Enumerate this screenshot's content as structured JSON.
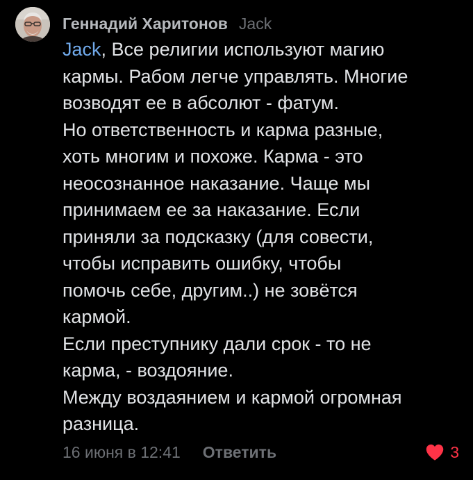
{
  "comment": {
    "author": "Геннадий Харитонов",
    "reply_to": "Jack",
    "mention": "Jack",
    "first_line_rest": ", Все религии используют магию",
    "lines": [
      "кармы. Рабом легче управлять. Многие",
      "возводят ее в абсолют - фатум.",
      "Но ответственность и карма разные,",
      "хоть многим и похоже. Карма - это",
      "неосознанное наказание. Чаще мы",
      "принимаем ее за наказание. Если",
      "приняли за подсказку (для совести,",
      "чтобы исправить ошибку, чтобы",
      "помочь себе, другим..) не зовётся",
      "кармой.",
      "Если преступнику дали срок - то не",
      "карма, - воздояние.",
      "Между воздаянием и кармой огромная",
      "разница."
    ],
    "date": "16 июня в 12:41",
    "reply_label": "Ответить",
    "like_count": "3",
    "like_icon": "heart-icon",
    "avatar_icon": "user-avatar"
  },
  "colors": {
    "background": "#000000",
    "text": "#e1e3e6",
    "author": "#b6b9bd",
    "muted": "#6d7075",
    "mention": "#71aaeb",
    "like": "#ff3347"
  }
}
